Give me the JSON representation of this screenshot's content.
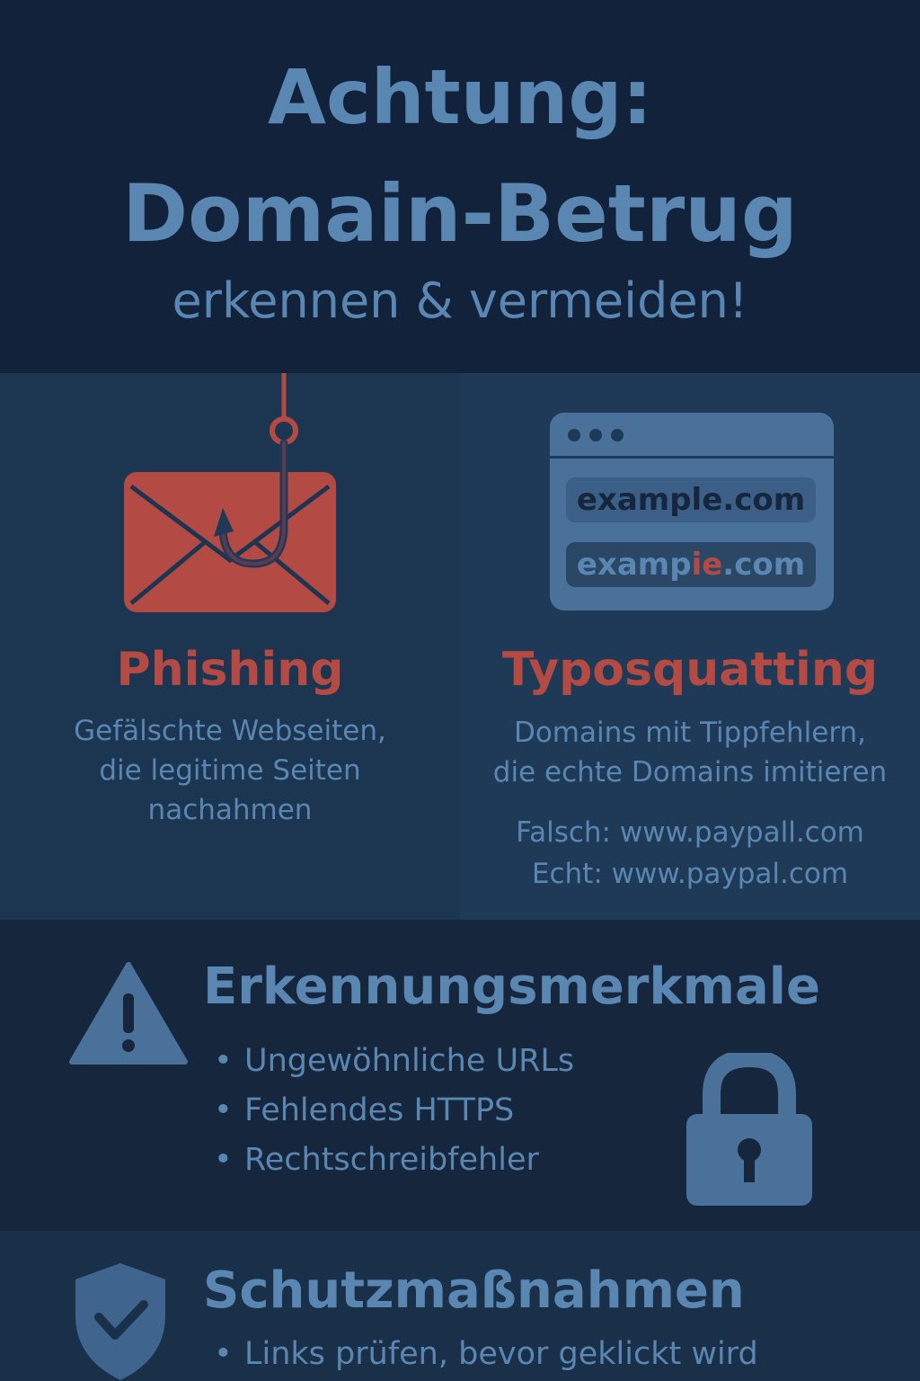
{
  "header": {
    "title_line1": "Achtung:",
    "title_line2": "Domain-Betrug",
    "subtitle": "erkennen & vermeiden!"
  },
  "phishing": {
    "heading": "Phishing",
    "desc_line1": "Gefälschte Webseiten,",
    "desc_line2": "die legitime Seiten",
    "desc_line3": "nachahmen"
  },
  "typosquatting": {
    "heading": "Typosquatting",
    "url_real": "example.com",
    "url_fake_part1": "examp",
    "url_fake_part2": "ie",
    "url_fake_part3": ".com",
    "desc_line1": "Domains mit Tippfehlern,",
    "desc_line2": "die echte Domains imitieren",
    "example_wrong": "Falsch: www.paypall.com",
    "example_right": "Echt: www.paypal.com"
  },
  "signs": {
    "heading": "Erkennungsmerkmale",
    "items": [
      "Ungewöhnliche URLs",
      "Fehlendes HTTPS",
      "Rechtschreibfehler"
    ]
  },
  "protection": {
    "heading": "Schutzmaßnahmen",
    "items": [
      "Links prüfen, bevor geklickt wird"
    ]
  },
  "bullet_char": "•",
  "colors": {
    "accent_red": "#b34a44",
    "text_blue": "#5a86b2",
    "bg_dark": "#12223a"
  },
  "icons": [
    "envelope-icon",
    "fishing-hook-icon",
    "browser-window-icon",
    "warning-icon",
    "padlock-icon",
    "shield-check-icon"
  ]
}
